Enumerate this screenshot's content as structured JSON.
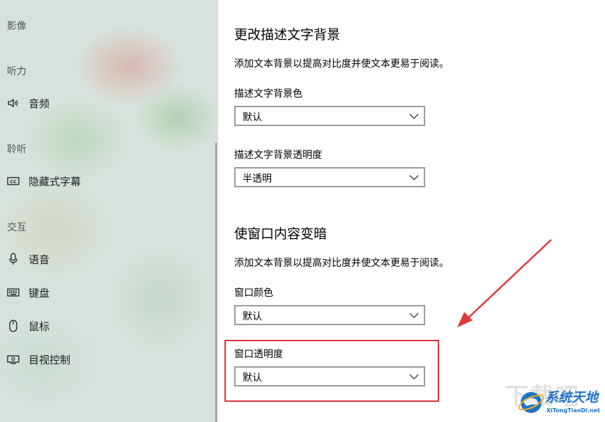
{
  "sidebar": {
    "sections": [
      {
        "key": "sec_video",
        "label": "影像"
      },
      {
        "key": "sec_hearing",
        "label": "听力"
      },
      {
        "key": "sec_listen",
        "label": "聆听"
      },
      {
        "key": "sec_interact",
        "label": "交互"
      }
    ],
    "items": [
      {
        "label": "音频",
        "icon": "speaker-icon"
      },
      {
        "label": "隐藏式字幕",
        "icon": "closed-captions-icon"
      },
      {
        "label": "语音",
        "icon": "microphone-icon"
      },
      {
        "label": "键盘",
        "icon": "keyboard-icon"
      },
      {
        "label": "鼠标",
        "icon": "mouse-icon"
      },
      {
        "label": "目视控制",
        "icon": "eye-control-icon"
      }
    ]
  },
  "main": {
    "section1": {
      "title": "更改描述文字背景",
      "description": "添加文本背景以提高对比度并使文本更易于阅读。",
      "fields": [
        {
          "label": "描述文字背景色",
          "value": "默认"
        },
        {
          "label": "描述文字背景透明度",
          "value": "半透明"
        }
      ]
    },
    "section2": {
      "title": "使窗口内容变暗",
      "description": "添加文本背景以提高对比度并使文本更易于阅读。",
      "fields": [
        {
          "label": "窗口颜色",
          "value": "默认"
        },
        {
          "label": "窗口透明度",
          "value": "默认"
        }
      ]
    }
  },
  "watermark": {
    "title": "系统天地",
    "url": "XiTongTianDi.net",
    "ghost": "下载吧"
  },
  "colors": {
    "highlight": "#d9323a",
    "watermark": "#1d73c9",
    "select_border": "#9a9a9a"
  }
}
